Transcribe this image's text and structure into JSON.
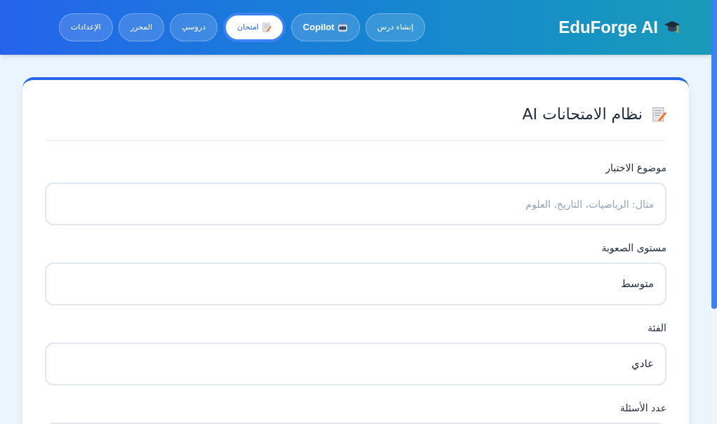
{
  "header": {
    "logo": "EduForge AI",
    "nav": [
      {
        "label": "إنشاء درس",
        "kind": "plain",
        "selected": false
      },
      {
        "label": "Copilot",
        "kind": "robot",
        "selected": false
      },
      {
        "label": "امتحان",
        "kind": "memo",
        "selected": true
      },
      {
        "label": "دروسي",
        "kind": "plain",
        "selected": false
      },
      {
        "label": "المحرر",
        "kind": "plain",
        "selected": false
      },
      {
        "label": "الإعدادات",
        "kind": "plain",
        "selected": false
      }
    ]
  },
  "card": {
    "title": "نظام الامتحانات AI",
    "fields": [
      {
        "label": "موضوع الاختبار",
        "kind": "input",
        "placeholder": "مثال: الرياضيات، التاريخ، العلوم"
      },
      {
        "label": "مستوى الصعوبة",
        "kind": "select",
        "value": "متوسط"
      },
      {
        "label": "الفئة",
        "kind": "select",
        "value": "عادي"
      },
      {
        "label": "عدد الأسئلة",
        "kind": "input"
      }
    ]
  }
}
